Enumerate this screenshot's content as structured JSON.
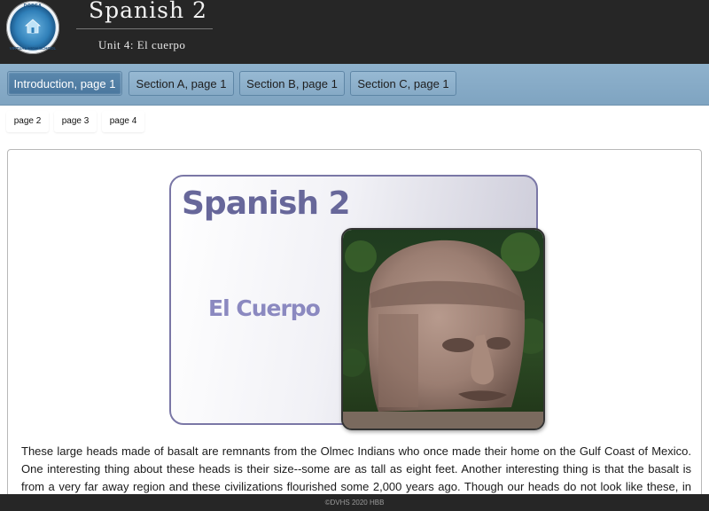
{
  "header": {
    "logo": {
      "top_text": "DODEA",
      "bottom_text": "VIRTUAL HIGH SCHOOL",
      "icon": "school-house-icon"
    },
    "title": "Spanish 2",
    "unit": "Unit 4: El cuerpo"
  },
  "nav": {
    "tabs": [
      {
        "label": "Introduction, page 1",
        "active": true
      },
      {
        "label": "Section A, page 1",
        "active": false
      },
      {
        "label": "Section B, page 1",
        "active": false
      },
      {
        "label": "Section C, page 1",
        "active": false
      }
    ]
  },
  "subnav": {
    "pages": [
      "page 2",
      "page 3",
      "page 4"
    ]
  },
  "content": {
    "banner": {
      "title": "Spanish 2",
      "subtitle": "El Cuerpo"
    },
    "paragraph": "These large heads made of basalt are remnants from the Olmec Indians who once made their home on the Gulf Coast of Mexico. One interesting thing about these heads is their size--some are as tall as eight feet. Another interesting thing is that the basalt is from a very far away region and these civilizations flourished some 2,000 years ago. Though our heads do not look like these, in Unit Four, we are"
  },
  "footer": {
    "text": "©DVHS 2020 HBB"
  },
  "colors": {
    "header_bg": "#262626",
    "nav_bg": "#8fb2cd",
    "active_tab": "#4a779e",
    "banner_title": "#67679a",
    "banner_sub": "#8b89c0"
  }
}
